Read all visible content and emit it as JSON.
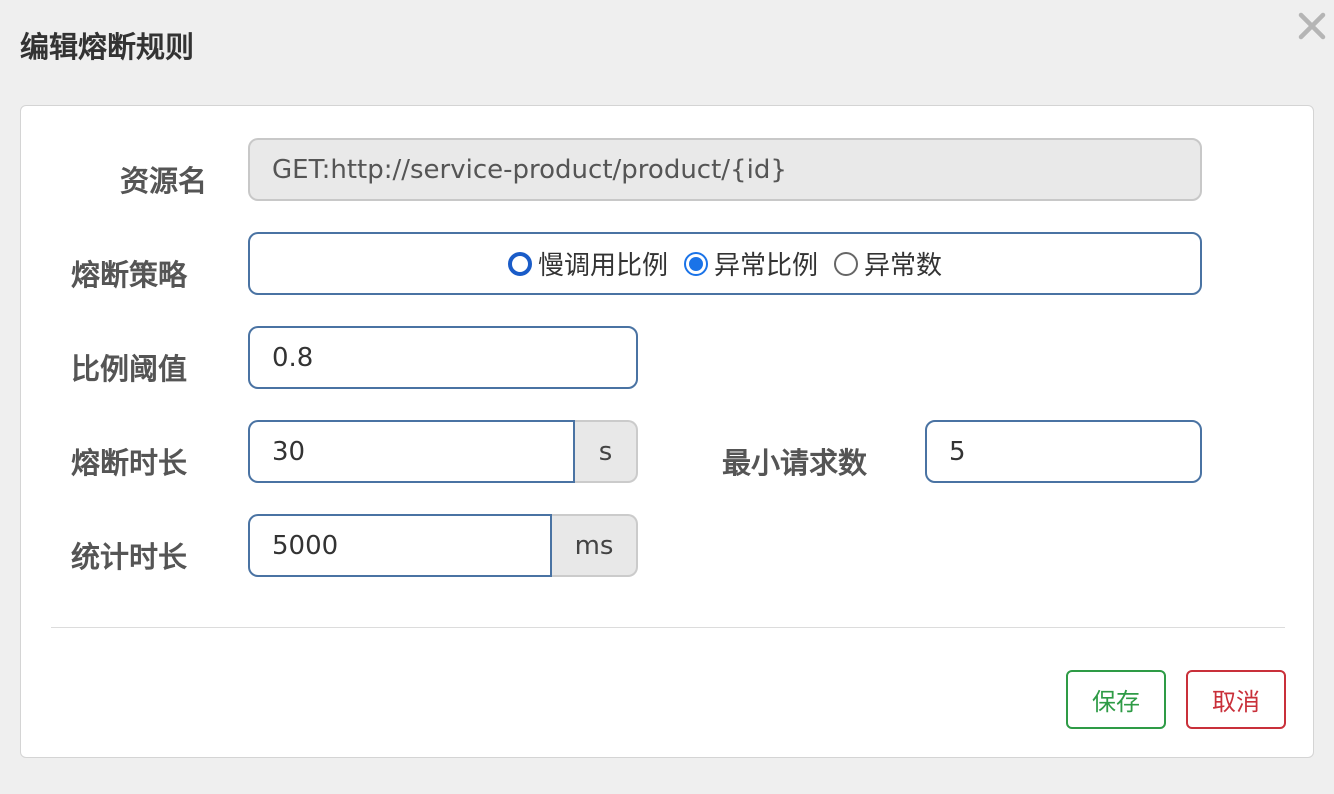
{
  "dialog": {
    "title": "编辑熔断规则"
  },
  "form": {
    "resource": {
      "label": "资源名",
      "value": "GET:http://service-product/product/{id}"
    },
    "strategy": {
      "label": "熔断策略",
      "options": [
        "慢调用比例",
        "异常比例",
        "异常数"
      ],
      "selected": "异常比例"
    },
    "ratio_threshold": {
      "label": "比例阈值",
      "value": "0.8"
    },
    "break_duration": {
      "label": "熔断时长",
      "value": "30",
      "unit": "s"
    },
    "min_requests": {
      "label": "最小请求数",
      "value": "5"
    },
    "stat_duration": {
      "label": "统计时长",
      "value": "5000",
      "unit": "ms"
    }
  },
  "footer": {
    "save_label": "保存",
    "cancel_label": "取消"
  },
  "colors": {
    "accent": "#1a73e8",
    "save": "#2e9b46",
    "cancel": "#c9303a",
    "input_border": "#4a73a3"
  },
  "icons": {
    "close": "close-icon"
  }
}
